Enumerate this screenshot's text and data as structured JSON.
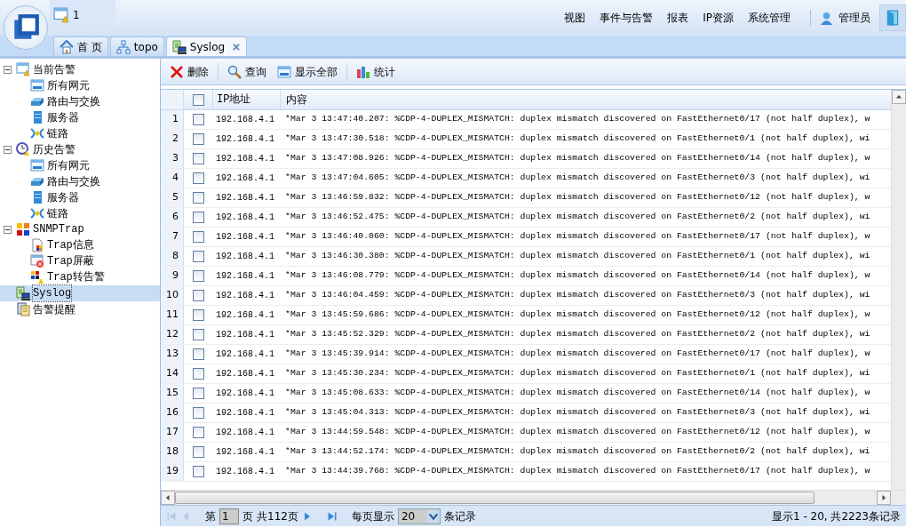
{
  "header": {
    "alert_count": "1",
    "menu": [
      "视图",
      "事件与告警",
      "报表",
      "IP资源",
      "系统管理"
    ],
    "user": "管理员"
  },
  "tabs": [
    {
      "label": "首 页",
      "kind": "home",
      "selected": false,
      "closable": false
    },
    {
      "label": "topo",
      "kind": "topo",
      "selected": false,
      "closable": false
    },
    {
      "label": "Syslog",
      "kind": "syslog",
      "selected": true,
      "closable": true
    }
  ],
  "sidebar": {
    "items": [
      {
        "label": "当前告警",
        "kind": "alarm",
        "expanded": true,
        "selected": false,
        "children": [
          {
            "label": "所有网元",
            "kind": "all",
            "selected": false
          },
          {
            "label": "路由与交换",
            "kind": "switch",
            "selected": false
          },
          {
            "label": "服务器",
            "kind": "server",
            "selected": false
          },
          {
            "label": "链路",
            "kind": "link",
            "selected": false
          }
        ]
      },
      {
        "label": "历史告警",
        "kind": "history",
        "expanded": true,
        "selected": false,
        "children": [
          {
            "label": "所有网元",
            "kind": "all",
            "selected": false
          },
          {
            "label": "路由与交换",
            "kind": "switch",
            "selected": false
          },
          {
            "label": "服务器",
            "kind": "server",
            "selected": false
          },
          {
            "label": "链路",
            "kind": "link",
            "selected": false
          }
        ]
      },
      {
        "label": "SNMPTrap",
        "kind": "snmp",
        "expanded": true,
        "selected": false,
        "children": [
          {
            "label": "Trap信息",
            "kind": "trapinfo",
            "selected": false
          },
          {
            "label": "Trap屏蔽",
            "kind": "trapmask",
            "selected": false
          },
          {
            "label": "Trap转告警",
            "kind": "trapalarm",
            "selected": false
          }
        ]
      },
      {
        "label": "Syslog",
        "kind": "syslog",
        "selected": true
      },
      {
        "label": "告警提醒",
        "kind": "reminder",
        "selected": false
      }
    ]
  },
  "toolbar": [
    {
      "label": "删除",
      "kind": "delete"
    },
    {
      "label": "查询",
      "kind": "search"
    },
    {
      "label": "显示全部",
      "kind": "all"
    },
    {
      "label": "统计",
      "kind": "stats"
    }
  ],
  "table": {
    "columns": [
      "IP地址",
      "内容"
    ],
    "all_checked": false,
    "rows": [
      {
        "number": "1",
        "checked": false,
        "ip": "192.168.4.1",
        "content": "*Mar 3 13:47:40.207: %CDP-4-DUPLEX_MISMATCH: duplex mismatch discovered on FastEthernet0/17 (not half duplex), w"
      },
      {
        "number": "2",
        "checked": false,
        "ip": "192.168.4.1",
        "content": "*Mar 3 13:47:30.518: %CDP-4-DUPLEX_MISMATCH: duplex mismatch discovered on FastEthernet0/1 (not half duplex), wi"
      },
      {
        "number": "3",
        "checked": false,
        "ip": "192.168.4.1",
        "content": "*Mar 3 13:47:08.926: %CDP-4-DUPLEX_MISMATCH: duplex mismatch discovered on FastEthernet0/14 (not half duplex), w"
      },
      {
        "number": "4",
        "checked": false,
        "ip": "192.168.4.1",
        "content": "*Mar 3 13:47:04.605: %CDP-4-DUPLEX_MISMATCH: duplex mismatch discovered on FastEthernet0/3 (not half duplex), wi"
      },
      {
        "number": "5",
        "checked": false,
        "ip": "192.168.4.1",
        "content": "*Mar 3 13:46:59.832: %CDP-4-DUPLEX_MISMATCH: duplex mismatch discovered on FastEthernet0/12 (not half duplex), w"
      },
      {
        "number": "6",
        "checked": false,
        "ip": "192.168.4.1",
        "content": "*Mar 3 13:46:52.475: %CDP-4-DUPLEX_MISMATCH: duplex mismatch discovered on FastEthernet0/2 (not half duplex), wi"
      },
      {
        "number": "7",
        "checked": false,
        "ip": "192.168.4.1",
        "content": "*Mar 3 13:46:40.060: %CDP-4-DUPLEX_MISMATCH: duplex mismatch discovered on FastEthernet0/17 (not half duplex), w"
      },
      {
        "number": "8",
        "checked": false,
        "ip": "192.168.4.1",
        "content": "*Mar 3 13:46:30.380: %CDP-4-DUPLEX_MISMATCH: duplex mismatch discovered on FastEthernet0/1 (not half duplex), wi"
      },
      {
        "number": "9",
        "checked": false,
        "ip": "192.168.4.1",
        "content": "*Mar 3 13:46:08.779: %CDP-4-DUPLEX_MISMATCH: duplex mismatch discovered on FastEthernet0/14 (not half duplex), w"
      },
      {
        "number": "10",
        "checked": false,
        "ip": "192.168.4.1",
        "content": "*Mar 3 13:46:04.459: %CDP-4-DUPLEX_MISMATCH: duplex mismatch discovered on FastEthernet0/3 (not half duplex), wi"
      },
      {
        "number": "11",
        "checked": false,
        "ip": "192.168.4.1",
        "content": "*Mar 3 13:45:59.686: %CDP-4-DUPLEX_MISMATCH: duplex mismatch discovered on FastEthernet0/12 (not half duplex), w"
      },
      {
        "number": "12",
        "checked": false,
        "ip": "192.168.4.1",
        "content": "*Mar 3 13:45:52.329: %CDP-4-DUPLEX_MISMATCH: duplex mismatch discovered on FastEthernet0/2 (not half duplex), wi"
      },
      {
        "number": "13",
        "checked": false,
        "ip": "192.168.4.1",
        "content": "*Mar 3 13:45:39.914: %CDP-4-DUPLEX_MISMATCH: duplex mismatch discovered on FastEthernet0/17 (not half duplex), w"
      },
      {
        "number": "14",
        "checked": false,
        "ip": "192.168.4.1",
        "content": "*Mar 3 13:45:30.234: %CDP-4-DUPLEX_MISMATCH: duplex mismatch discovered on FastEthernet0/1 (not half duplex), wi"
      },
      {
        "number": "15",
        "checked": false,
        "ip": "192.168.4.1",
        "content": "*Mar 3 13:45:08.633: %CDP-4-DUPLEX_MISMATCH: duplex mismatch discovered on FastEthernet0/14 (not half duplex), w"
      },
      {
        "number": "16",
        "checked": false,
        "ip": "192.168.4.1",
        "content": "*Mar 3 13:45:04.313: %CDP-4-DUPLEX_MISMATCH: duplex mismatch discovered on FastEthernet0/3 (not half duplex), wi"
      },
      {
        "number": "17",
        "checked": false,
        "ip": "192.168.4.1",
        "content": "*Mar 3 13:44:59.548: %CDP-4-DUPLEX_MISMATCH: duplex mismatch discovered on FastEthernet0/12 (not half duplex), w"
      },
      {
        "number": "18",
        "checked": false,
        "ip": "192.168.4.1",
        "content": "*Mar 3 13:44:52.174: %CDP-4-DUPLEX_MISMATCH: duplex mismatch discovered on FastEthernet0/2 (not half duplex), wi"
      },
      {
        "number": "19",
        "checked": false,
        "ip": "192.168.4.1",
        "content": "*Mar 3 13:44:39.768: %CDP-4-DUPLEX_MISMATCH: duplex mismatch discovered on FastEthernet0/17 (not half duplex), w"
      }
    ]
  },
  "pager": {
    "page_prefix": "第",
    "page": "1",
    "page_suffix": "页",
    "total_pages": "共112页",
    "per_page_label": "每页显示",
    "per_page": "20",
    "per_page_suffix": "条记录",
    "summary": "显示1 - 20, 共2223条记录"
  }
}
